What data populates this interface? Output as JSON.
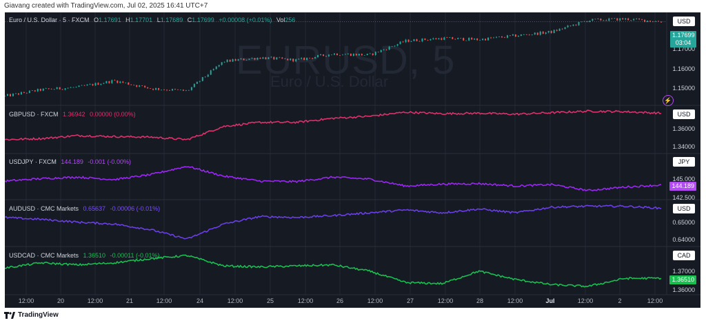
{
  "caption": "Giavang created with TradingView.com, Jul 02, 2025 16:41 UTC+7",
  "watermark": {
    "symbol": "EURUSD, 5",
    "name": "Euro / U.S. Dollar"
  },
  "branding": "TradingView",
  "colors": {
    "background": "#151a23",
    "grid": "#232836",
    "up": "#26a69a",
    "down": "#ef5350",
    "gbp": "#e0306c",
    "jpy": "#9c27f5",
    "aud": "#6a3ee8",
    "cad": "#19c050"
  },
  "panes": [
    {
      "id": "eurusd",
      "legend": {
        "symbol": "Euro / U.S. Dollar · 5 · FXCM",
        "o_label": "O",
        "o": "1.17691",
        "h_label": "H",
        "h": "1.17701",
        "l_label": "L",
        "l": "1.17689",
        "c_label": "C",
        "c": "1.17699",
        "chg": "+0.00008 (+0.01%)",
        "vol_label": "Vol",
        "vol": "256"
      },
      "currency": "USD",
      "price_tag": "1.17699",
      "countdown": "03:04",
      "axis_labels": [
        "1.17000",
        "1.16000",
        "1.15000"
      ]
    },
    {
      "id": "gbpusd",
      "legend": {
        "symbol": "GBPUSD · FXCM",
        "value": "1.36942",
        "chg": "0.00000 (0.00%)"
      },
      "currency": "USD",
      "axis_labels": [
        "1.36000",
        "1.34000"
      ]
    },
    {
      "id": "usdjpy",
      "legend": {
        "symbol": "USDJPY · FXCM",
        "value": "144.189",
        "chg": "-0.001 (-0.00%)"
      },
      "currency": "JPY",
      "price_tag": "144.189",
      "axis_labels": [
        "145.000",
        "142.500"
      ]
    },
    {
      "id": "audusd",
      "legend": {
        "symbol": "AUDUSD · CMC Markets",
        "value": "0.65637",
        "chg": "-0.00006 (-0.01%)"
      },
      "currency": "USD",
      "axis_labels": [
        "0.65000",
        "0.64000"
      ]
    },
    {
      "id": "usdcad",
      "legend": {
        "symbol": "USDCAD · CMC Markets",
        "value": "1.36510",
        "chg": "-0.00011 (-0.01%)"
      },
      "currency": "CAD",
      "price_tag": "1.36510",
      "axis_labels": [
        "1.37000",
        "1.36000"
      ]
    }
  ],
  "x_axis": [
    "12:00",
    "20",
    "12:00",
    "21",
    "12:00",
    "24",
    "12:00",
    "25",
    "12:00",
    "26",
    "12:00",
    "27",
    "12:00",
    "28",
    "12:00",
    "Jul",
    "12:00",
    "2",
    "12:00"
  ],
  "chart_data": [
    {
      "type": "line",
      "title": "Euro / U.S. Dollar · 5 · FXCM",
      "ylim": [
        1.145,
        1.179
      ],
      "x": [
        "12:00",
        "20",
        "12:00",
        "21",
        "12:00",
        "24",
        "12:00",
        "25",
        "12:00",
        "26",
        "12:00",
        "27",
        "12:00",
        "28",
        "12:00",
        "Jul",
        "12:00",
        "2",
        "12:00"
      ],
      "series": [
        {
          "values": [
            1.1475,
            1.15,
            1.151,
            1.1535,
            1.1505,
            1.1495,
            1.161,
            1.1625,
            1.1615,
            1.164,
            1.1635,
            1.169,
            1.17,
            1.1695,
            1.171,
            1.1725,
            1.177,
            1.1775,
            1.1765
          ]
        }
      ]
    },
    {
      "type": "line",
      "title": "GBPUSD · FXCM",
      "ylim": [
        1.333,
        1.375
      ],
      "x": [
        "12:00",
        "20",
        "12:00",
        "21",
        "12:00",
        "24",
        "12:00",
        "25",
        "12:00",
        "26",
        "12:00",
        "27",
        "12:00",
        "28",
        "12:00",
        "Jul",
        "12:00",
        "2",
        "12:00"
      ],
      "series": [
        {
          "values": [
            1.344,
            1.345,
            1.348,
            1.347,
            1.3465,
            1.344,
            1.357,
            1.361,
            1.361,
            1.365,
            1.367,
            1.371,
            1.3695,
            1.37,
            1.369,
            1.3705,
            1.372,
            1.3715,
            1.37
          ]
        }
      ]
    },
    {
      "type": "line",
      "title": "USDJPY · FXCM",
      "ylim": [
        141.8,
        150.0
      ],
      "x": [
        "12:00",
        "20",
        "12:00",
        "21",
        "12:00",
        "24",
        "12:00",
        "25",
        "12:00",
        "26",
        "12:00",
        "27",
        "12:00",
        "28",
        "12:00",
        "Jul",
        "12:00",
        "2",
        "12:00"
      ],
      "series": [
        {
          "values": [
            145.0,
            145.5,
            145.8,
            145.3,
            146.3,
            148.0,
            146.0,
            145.0,
            144.9,
            145.8,
            145.4,
            144.0,
            144.4,
            144.5,
            144.0,
            144.3,
            143.1,
            143.8,
            144.2
          ]
        }
      ]
    },
    {
      "type": "line",
      "title": "AUDUSD · CMC Markets",
      "ylim": [
        0.6375,
        0.6595
      ],
      "x": [
        "12:00",
        "20",
        "12:00",
        "21",
        "12:00",
        "24",
        "12:00",
        "25",
        "12:00",
        "26",
        "12:00",
        "27",
        "12:00",
        "28",
        "12:00",
        "Jul",
        "12:00",
        "2",
        "12:00"
      ],
      "series": [
        {
          "values": [
            0.6515,
            0.6505,
            0.649,
            0.648,
            0.645,
            0.64,
            0.648,
            0.652,
            0.6515,
            0.6525,
            0.654,
            0.6555,
            0.654,
            0.656,
            0.654,
            0.657,
            0.6575,
            0.6575,
            0.6564
          ]
        }
      ]
    },
    {
      "type": "line",
      "title": "USDCAD · CMC Markets",
      "ylim": [
        1.3585,
        1.379
      ],
      "x": [
        "12:00",
        "20",
        "12:00",
        "21",
        "12:00",
        "24",
        "12:00",
        "25",
        "12:00",
        "26",
        "12:00",
        "27",
        "12:00",
        "28",
        "12:00",
        "Jul",
        "12:00",
        "2",
        "12:00"
      ],
      "series": [
        {
          "values": [
            1.37,
            1.3725,
            1.3715,
            1.3725,
            1.3745,
            1.376,
            1.371,
            1.3705,
            1.371,
            1.3715,
            1.3685,
            1.363,
            1.3625,
            1.3685,
            1.3645,
            1.362,
            1.3612,
            1.365,
            1.3651
          ]
        }
      ]
    }
  ]
}
